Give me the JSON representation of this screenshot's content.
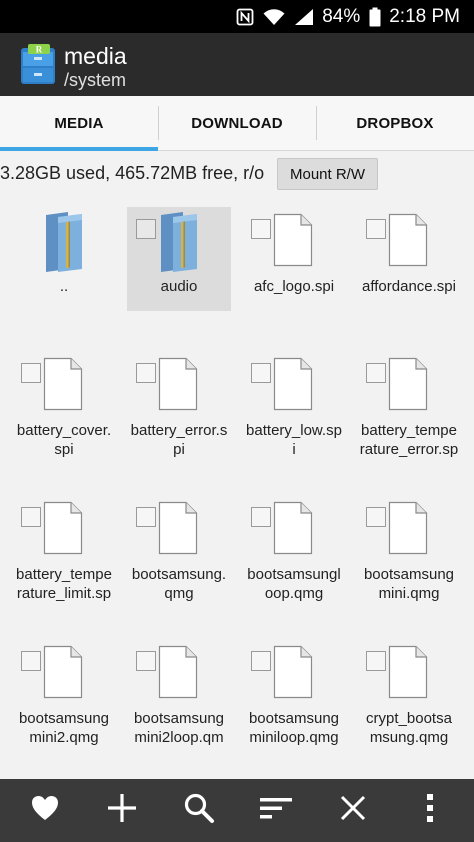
{
  "status_bar": {
    "icons": [
      "nfc-icon",
      "wifi-icon",
      "signal-icon",
      "battery-icon"
    ],
    "battery": "84%",
    "time": "2:18 PM"
  },
  "app_bar": {
    "title": "media",
    "subtitle": "/system",
    "logo": "root-explorer-logo"
  },
  "tabs": [
    {
      "label": "MEDIA",
      "active": true
    },
    {
      "label": "DOWNLOAD",
      "active": false
    },
    {
      "label": "DROPBOX",
      "active": false
    }
  ],
  "info": {
    "storage": "3.28GB used, 465.72MB free, r/o",
    "mount_button": "Mount R/W"
  },
  "files": [
    {
      "name": "..",
      "type": "folder"
    },
    {
      "name": "audio",
      "type": "folder",
      "selected": true
    },
    {
      "name": "afc_logo.spi",
      "type": "file"
    },
    {
      "name": "affordance.spi",
      "type": "file"
    },
    {
      "name": "battery_cover.\nspi",
      "type": "file"
    },
    {
      "name": "battery_error.s\npi",
      "type": "file"
    },
    {
      "name": "battery_low.sp\ni",
      "type": "file"
    },
    {
      "name": "battery_tempe\nrature_error.sp",
      "type": "file"
    },
    {
      "name": "battery_tempe\nrature_limit.sp",
      "type": "file"
    },
    {
      "name": "bootsamsung.\nqmg",
      "type": "file"
    },
    {
      "name": "bootsamsungl\noop.qmg",
      "type": "file"
    },
    {
      "name": "bootsamsung\nmini.qmg",
      "type": "file"
    },
    {
      "name": "bootsamsung\nmini2.qmg",
      "type": "file"
    },
    {
      "name": "bootsamsung\nmini2loop.qm",
      "type": "file"
    },
    {
      "name": "bootsamsung\nminiloop.qmg",
      "type": "file"
    },
    {
      "name": "crypt_bootsa\nmsung.qmg",
      "type": "file"
    }
  ],
  "toolbar": [
    "heart-icon",
    "plus-icon",
    "search-icon",
    "sort-icon",
    "close-icon",
    "overflow-menu-icon"
  ],
  "colors": {
    "accent": "#3ea6e4",
    "app_bar": "#2b2b2b",
    "toolbar": "#3a3a3a",
    "background": "#f2f2f2"
  }
}
